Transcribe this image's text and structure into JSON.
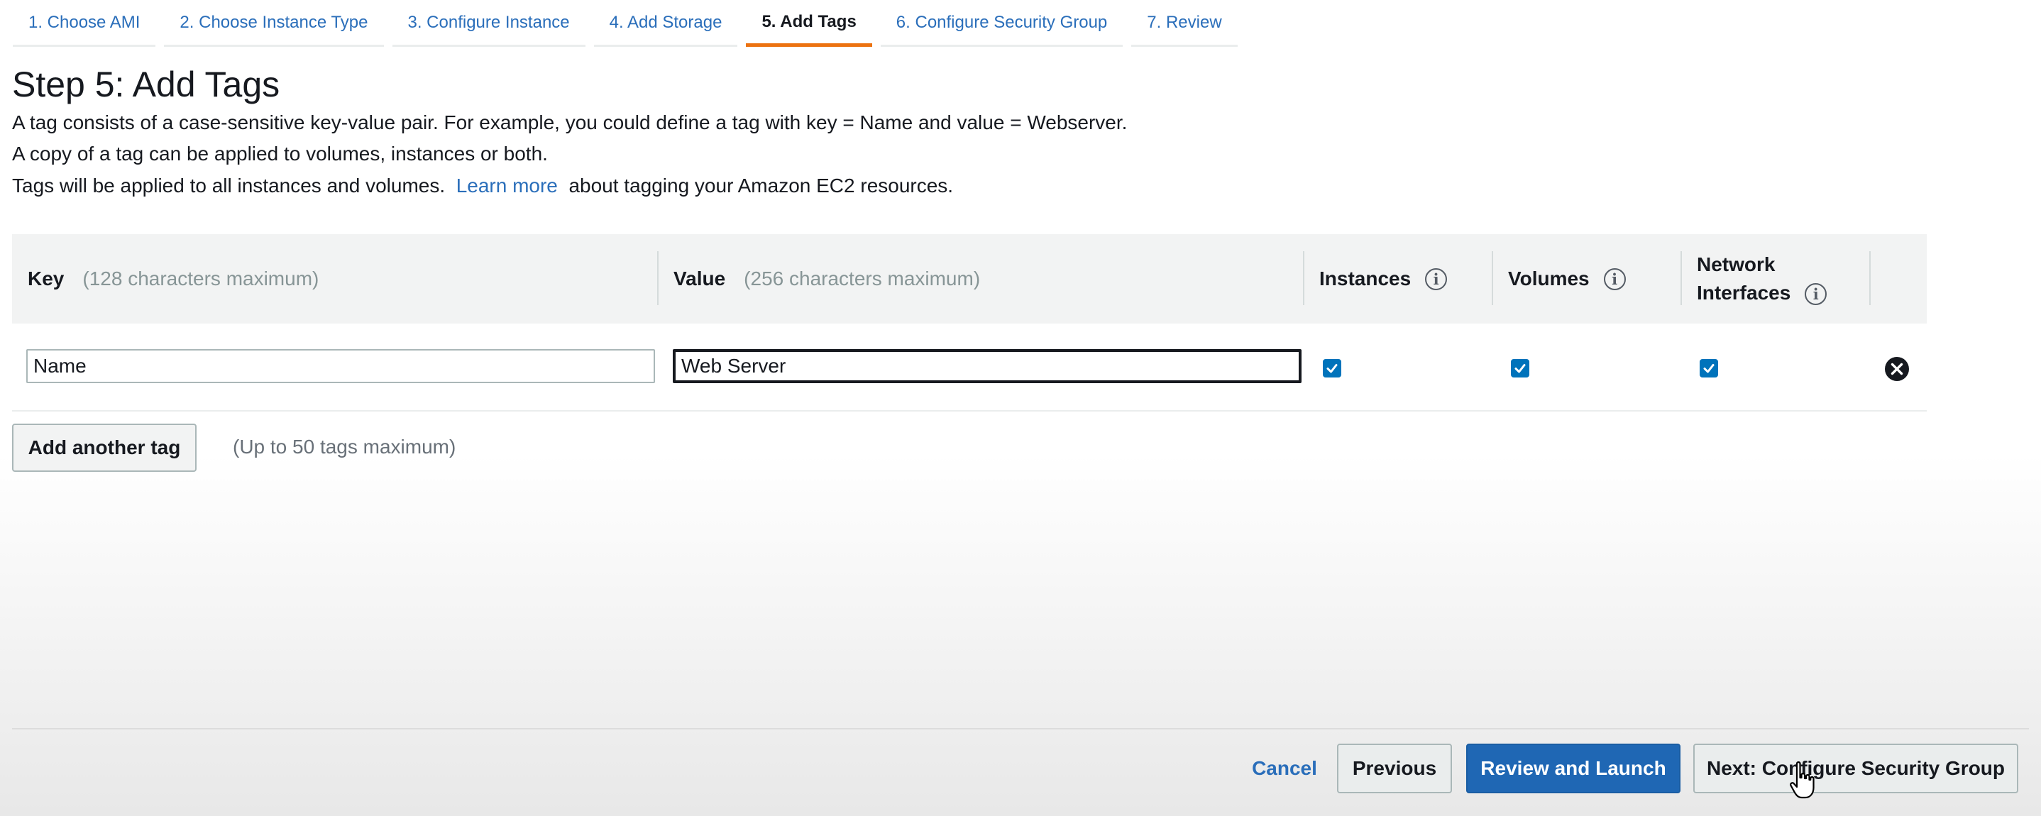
{
  "steps": [
    {
      "label": "1. Choose AMI"
    },
    {
      "label": "2. Choose Instance Type"
    },
    {
      "label": "3. Configure Instance"
    },
    {
      "label": "4. Add Storage"
    },
    {
      "label": "5. Add Tags"
    },
    {
      "label": "6. Configure Security Group"
    },
    {
      "label": "7. Review"
    }
  ],
  "active_step": "5. Add Tags",
  "page": {
    "title": "Step 5: Add Tags",
    "desc_line1": "A tag consists of a case-sensitive key-value pair. For example, you could define a tag with key = Name and value = Webserver.",
    "desc_line2": "A copy of a tag can be applied to volumes, instances or both.",
    "desc_line3_prefix": "Tags will be applied to all instances and volumes.",
    "learn_more": "Learn more",
    "desc_line3_suffix": "about tagging your Amazon EC2 resources."
  },
  "table": {
    "headers": {
      "key": "Key",
      "key_hint": "(128 characters maximum)",
      "value": "Value",
      "value_hint": "(256 characters maximum)",
      "instances": "Instances",
      "volumes": "Volumes",
      "network_line1": "Network",
      "network_line2": "Interfaces"
    },
    "rows": [
      {
        "key": "Name",
        "value": "Web Server",
        "instances": true,
        "volumes": true,
        "network_interfaces": true
      }
    ]
  },
  "add_tag": {
    "button": "Add another tag",
    "hint": "(Up to 50 tags maximum)"
  },
  "footer": {
    "cancel": "Cancel",
    "previous": "Previous",
    "review_launch": "Review and Launch",
    "next": "Next: Configure Security Group"
  },
  "icons": {
    "info": "info-icon",
    "remove": "remove-tag-icon",
    "checkbox": "checkbox-checked-icon"
  },
  "colors": {
    "link": "#2a6eba",
    "active_tab_underline": "#ec7211",
    "primary_button": "#1f67b4",
    "checkbox": "#0073bb"
  }
}
